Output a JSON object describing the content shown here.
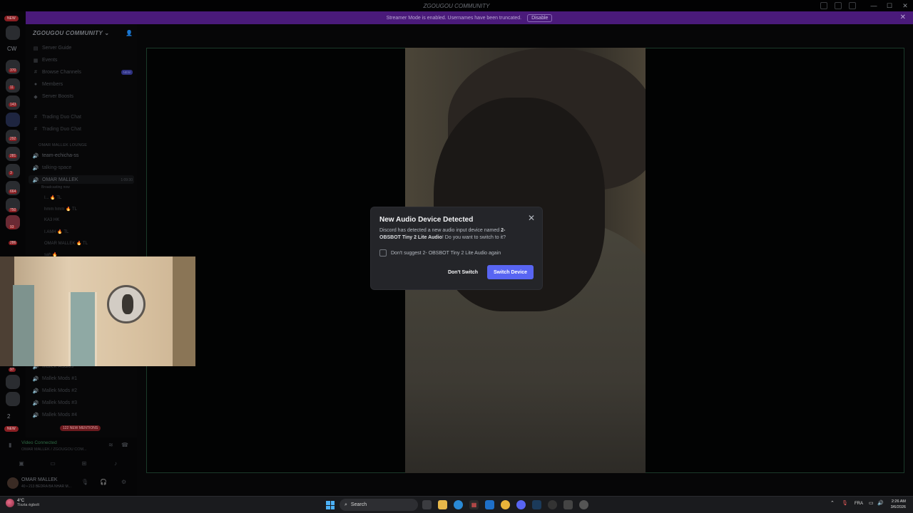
{
  "window": {
    "title": "ZGOUGOU COMMUNITY",
    "controls": [
      "—",
      "☐",
      "✕"
    ]
  },
  "banner": {
    "text": "Streamer Mode is enabled. Usernames have been truncated.",
    "disable_label": "Disable"
  },
  "rail": {
    "new_label": "NEW",
    "cw_label": "CW",
    "badges": [
      "370",
      "11",
      "143",
      "292",
      "281",
      "3",
      "664",
      "750",
      "93",
      "286",
      "97"
    ],
    "bottom_number": "2",
    "bottom_new_label": "NEW"
  },
  "sidebar": {
    "server_name": "ZGOUGOU COMMUNITY",
    "items": [
      {
        "label": "Server Guide"
      },
      {
        "label": "Events"
      },
      {
        "label": "Browse Channels",
        "tag": "NEW"
      },
      {
        "label": "Members"
      },
      {
        "label": "Server Boosts"
      }
    ],
    "text_channels": [
      "Trading Duo Chat",
      "Trading Duo Chat"
    ],
    "category": "OMAR MALLEK LOUNGE",
    "voice_channels": [
      "team-echicha-ss",
      "talking-space",
      "OMAR MALLEK"
    ],
    "active_channel_time": "1:09:30",
    "active_sub": "Broadcasting now",
    "voice_users": [
      "I... 🔥 TL",
      "hmm hmm 🔥 TL",
      "KA3 HK",
      "I.AMH 🔥 TL",
      "OMAR MALLEK 🔥 TL",
      "sah 🔥"
    ],
    "lower_channels": [
      "Mallek-Audios",
      "Mallek Mods #1",
      "Mallek Mods #2",
      "Mallek Mods #3",
      "Mallek Mods #4"
    ],
    "mentions": "122 NEW MENTIONS"
  },
  "voice_panel": {
    "status": "Video Connected",
    "channel": "OMAR MALLEK / ZGOUGOU COM..."
  },
  "user_panel": {
    "name": "OMAR MALLEK",
    "status": "40 • 213 BEDRA BA NHAR M..."
  },
  "modal": {
    "title": "New Audio Device Detected",
    "body_prefix": "Discord has detected a new audio input device named ",
    "device_name": "2- OBSBOT Tiny 2 Lite Audio",
    "body_suffix": "! Do you want to switch to it?",
    "checkbox_label": "Don't suggest 2- OBSBOT Tiny 2 Lite Audio again",
    "cancel_label": "Don't Switch",
    "confirm_label": "Switch Device",
    "close_icon": "✕"
  },
  "taskbar": {
    "weather_temp": "4°C",
    "weather_desc": "Tiszta égbolt",
    "search_label": "Search",
    "language": "FRA",
    "time": "2:26 AM",
    "date": "3/6/2026"
  },
  "colors": {
    "accent": "#5865f2",
    "banner": "#4a1a7a",
    "modal_bg": "#242529"
  }
}
